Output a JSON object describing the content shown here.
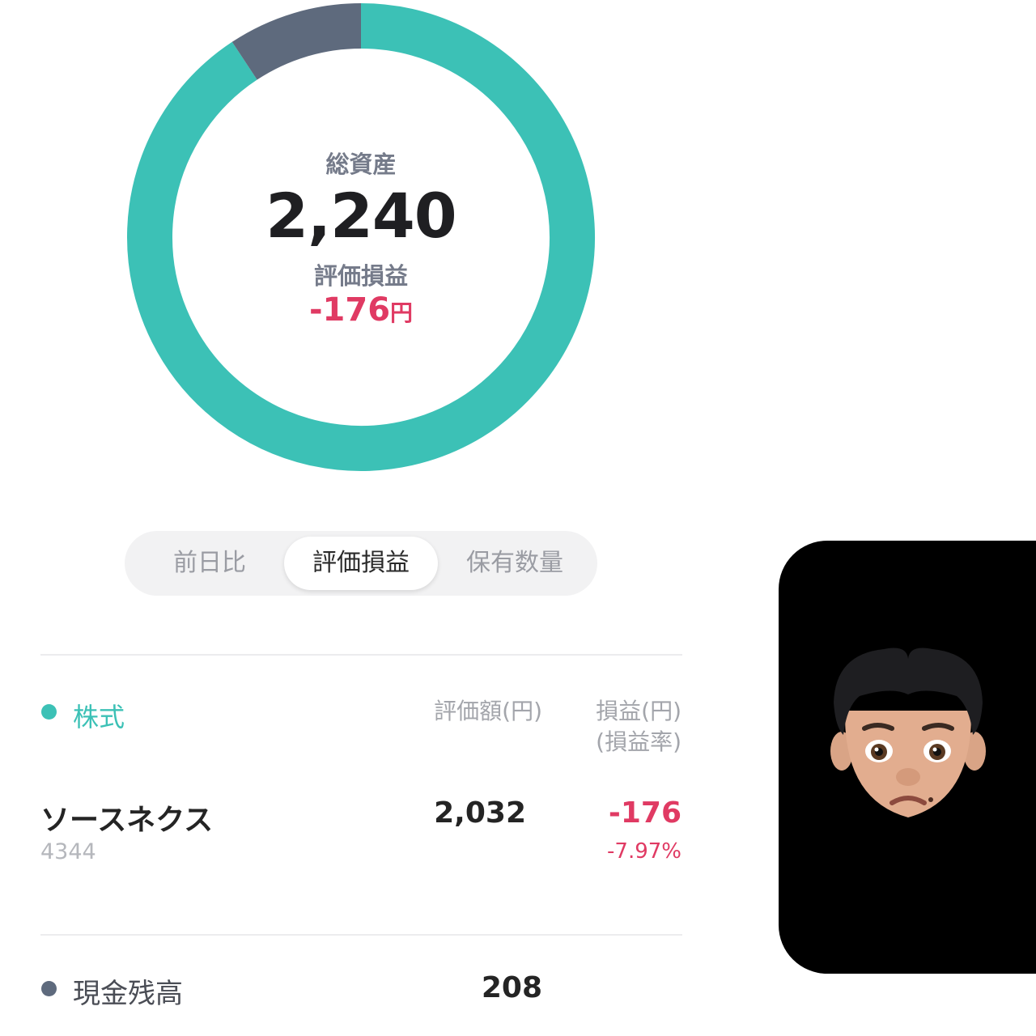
{
  "chart_data": {
    "type": "pie",
    "style": "donut",
    "categories": [
      "株式",
      "現金残高"
    ],
    "values": [
      2032,
      208
    ],
    "colors": [
      "#3cc1b6",
      "#5e6a7d"
    ]
  },
  "summary": {
    "total_label": "総資産",
    "total_value": "2,240",
    "pl_label": "評価損益",
    "pl_value": "-176",
    "pl_unit": "円"
  },
  "tabs": [
    {
      "label": "前日比",
      "active": false
    },
    {
      "label": "評価損益",
      "active": true
    },
    {
      "label": "保有数量",
      "active": false
    }
  ],
  "stocks": {
    "title": "株式",
    "dot_color": "#3cc1b6",
    "col_value": "評価額(円)",
    "col_pl_line1": "損益(円)",
    "col_pl_line2": "(損益率)",
    "items": [
      {
        "name": "ソースネクス",
        "code": "4344",
        "value": "2,032",
        "pl": "-176",
        "rate": "-7.97%"
      }
    ]
  },
  "cash": {
    "title": "現金残高",
    "dot_color": "#5e6a7d",
    "value": "208"
  },
  "avatar": {
    "icon": "memoji-avatar-icon"
  }
}
